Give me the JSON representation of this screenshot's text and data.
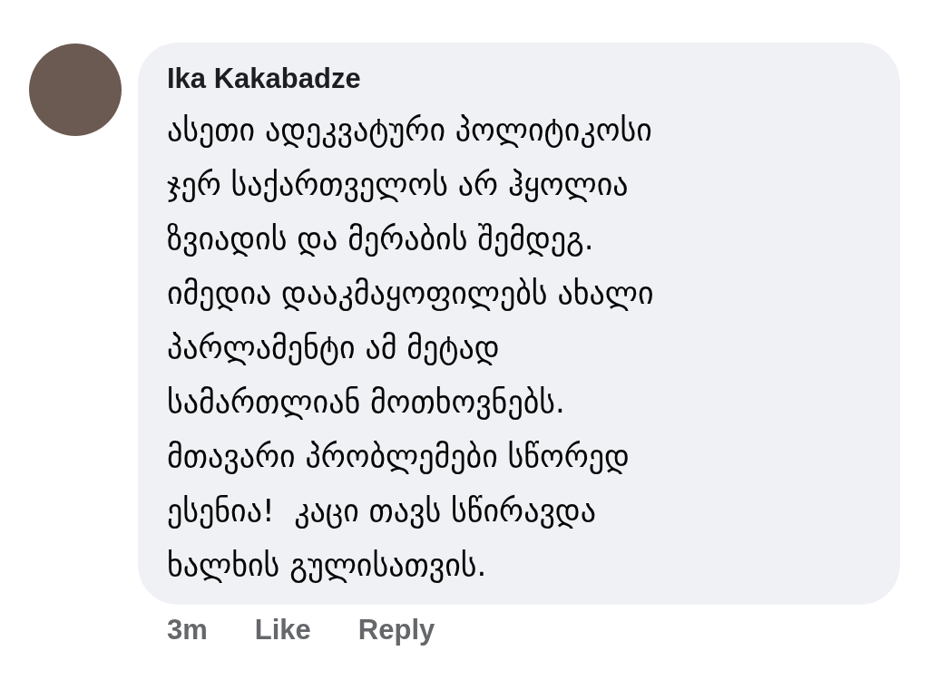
{
  "comment": {
    "author": "Ika Kakabadze",
    "body": "ასეთი ადეკვატური პოლიტიკოსი\nჯერ საქართველოს არ ჰყოლია\nზვიადის და მერაბის შემდეგ.\nიმედია დააკმაყოფილებს ახალი\nპარლამენტი ამ მეტად\nსამართლიან მოთხოვნებს.\nმთავარი პრობლემები სწორედ\nესენია!  კაცი თავს სწირავდა\nხალხის გულისათვის.",
    "time": "3m",
    "actions": [
      "Like",
      "Reply"
    ]
  }
}
